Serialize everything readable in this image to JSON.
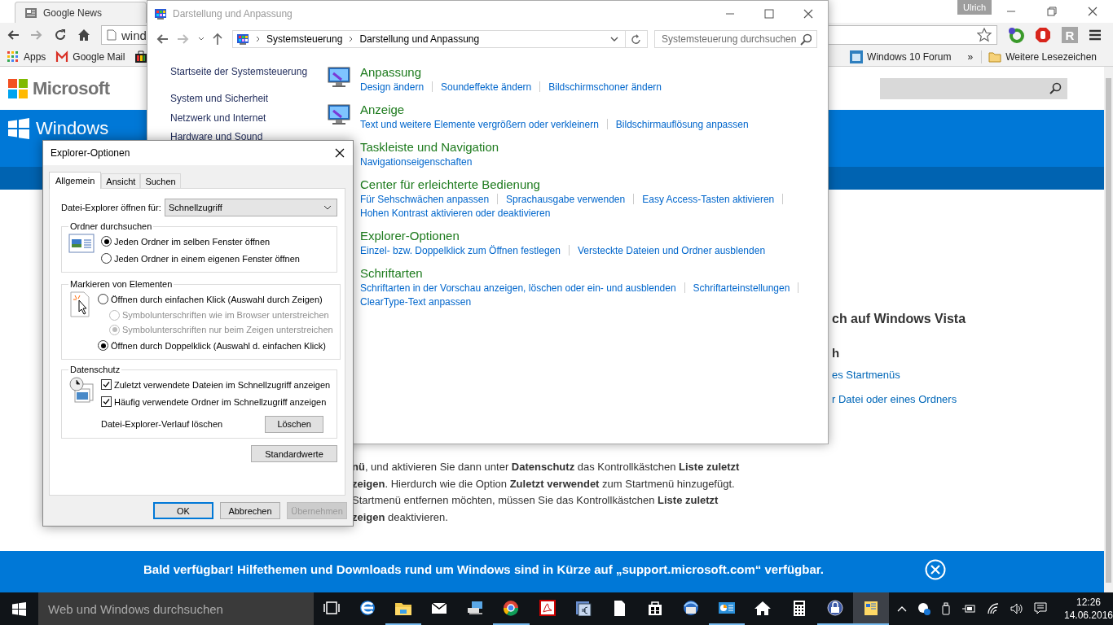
{
  "browser": {
    "tab": {
      "title": "Google News"
    },
    "profile": "Ulrich",
    "address": "wind",
    "extension_label": "R",
    "bookmarks": [
      {
        "kind": "apps",
        "label": "Apps"
      },
      {
        "kind": "mail",
        "label": "Google Mail"
      },
      {
        "kind": "bag"
      }
    ],
    "bookmarks_right": [
      {
        "kind": "forum",
        "label": "Windows 10 Forum"
      }
    ],
    "overflow": "»",
    "other_bookmarks": "Weitere Lesezeichen"
  },
  "site": {
    "brand": "Microsoft",
    "band_title": "Windows",
    "article": {
      "heading": "ch auf Windows Vista",
      "subheading": "h",
      "links": [
        "es Startmenüs",
        "r Datei oder eines Ordners"
      ],
      "paragraph_lines": [
        "**nü**, und aktivieren Sie dann unter **Datenschutz** das Kontrollkästchen **Liste zuletzt**",
        "**zeigen**. Hierdurch wie die Option **Zuletzt verwendet** zum Startmenü hinzugefügt.",
        "Startmenü entfernen möchten, müssen Sie das Kontrollkästchen **Liste zuletzt**",
        "**zeigen** deaktivieren."
      ]
    },
    "banner": {
      "text": "Bald verfügbar! Hilfethemen und Downloads rund um Windows sind in Kürze auf „support.microsoft.com“ verfügbar."
    }
  },
  "control_panel": {
    "title": "Darstellung und Anpassung",
    "breadcrumb": [
      "Systemsteuerung",
      "Darstellung und Anpassung"
    ],
    "search_placeholder": "Systemsteuerung durchsuchen",
    "nav": [
      "Startseite der Systemsteuerung",
      "System und Sicherheit",
      "Netzwerk und Internet",
      "Hardware und Sound"
    ],
    "categories": [
      {
        "title": "Anpassung",
        "link_rows": [
          [
            "Design ändern",
            "Soundeffekte ändern",
            "Bildschirmschoner ändern"
          ]
        ]
      },
      {
        "title": "Anzeige",
        "link_rows": [
          [
            "Text und weitere Elemente vergrößern oder verkleinern",
            "Bildschirmauflösung anpassen"
          ]
        ]
      },
      {
        "title": "Taskleiste und Navigation",
        "link_rows": [
          [
            "Navigationseigenschaften"
          ]
        ]
      },
      {
        "title": "Center für erleichterte Bedienung",
        "link_rows": [
          [
            "Für Sehschwächen anpassen",
            "Sprachausgabe verwenden",
            "Easy Access-Tasten aktivieren"
          ],
          [
            "Hohen Kontrast aktivieren oder deaktivieren"
          ]
        ]
      },
      {
        "title": "Explorer-Optionen",
        "link_rows": [
          [
            "Einzel- bzw. Doppelklick zum Öffnen festlegen",
            "Versteckte Dateien und Ordner ausblenden"
          ]
        ]
      },
      {
        "title": "Schriftarten",
        "link_rows": [
          [
            "Schriftarten in der Vorschau anzeigen, löschen oder ein- und ausblenden",
            "Schriftarteinstellungen"
          ],
          [
            "ClearType-Text anpassen"
          ]
        ]
      }
    ]
  },
  "dialog": {
    "title": "Explorer-Optionen",
    "tabs": [
      {
        "label": "Allgemein",
        "selected": true
      },
      {
        "label": "Ansicht",
        "selected": false
      },
      {
        "label": "Suchen",
        "selected": false
      }
    ],
    "open_in": {
      "label": "Datei-Explorer öffnen für:",
      "value": "Schnellzugriff"
    },
    "groups": [
      {
        "kind": "radios",
        "title": "Ordner durchsuchen",
        "options": [
          {
            "label": "Jeden Ordner im selben Fenster öffnen",
            "selected": true,
            "disabled": false
          },
          {
            "label": "Jeden Ordner in einem eigenen Fenster öffnen",
            "selected": false,
            "disabled": false
          }
        ]
      },
      {
        "kind": "radios",
        "title": "Markieren von Elementen",
        "options": [
          {
            "label": "Öffnen durch einfachen Klick (Auswahl durch Zeigen)",
            "selected": false,
            "disabled": false,
            "children": [
              {
                "label": "Symbolunterschriften wie im Browser unterstreichen",
                "selected": false,
                "disabled": true
              },
              {
                "label": "Symbolunterschriften nur beim Zeigen unterstreichen",
                "selected": true,
                "disabled": true
              }
            ]
          },
          {
            "label": "Öffnen durch Doppelklick (Auswahl d. einfachen Klick)",
            "selected": true,
            "disabled": false
          }
        ]
      },
      {
        "kind": "checks",
        "title": "Datenschutz",
        "options": [
          {
            "label": "Zuletzt verwendete Dateien im Schnellzugriff anzeigen",
            "checked": true
          },
          {
            "label": "Häufig verwendete Ordner im Schnellzugriff anzeigen",
            "checked": true
          }
        ],
        "clear": {
          "label": "Datei-Explorer-Verlauf löschen",
          "button": "Löschen"
        }
      }
    ],
    "defaults_button": "Standardwerte",
    "buttons": [
      {
        "label": "OK",
        "default": true,
        "disabled": false
      },
      {
        "label": "Abbrechen",
        "default": false,
        "disabled": false
      },
      {
        "label": "Übernehmen",
        "default": false,
        "disabled": true
      }
    ]
  },
  "taskbar": {
    "search_placeholder": "Web und Windows durchsuchen",
    "apps": [
      {
        "kind": "taskview",
        "running": false,
        "active": false
      },
      {
        "kind": "letter",
        "running": false,
        "active": false
      },
      {
        "kind": "folder",
        "running": true,
        "active": false
      },
      {
        "kind": "envelope",
        "running": false,
        "active": false
      },
      {
        "kind": "computer",
        "running": false,
        "active": false
      },
      {
        "kind": "ball",
        "running": true,
        "active": false
      },
      {
        "kind": "pdf",
        "running": false,
        "active": false
      },
      {
        "kind": "euro",
        "running": false,
        "active": false
      },
      {
        "kind": "page",
        "running": false,
        "active": false
      },
      {
        "kind": "bag",
        "running": false,
        "active": false
      },
      {
        "kind": "bird",
        "running": false,
        "active": false
      },
      {
        "kind": "chart",
        "running": true,
        "active": false
      },
      {
        "kind": "house",
        "running": false,
        "active": false
      },
      {
        "kind": "calculator",
        "running": false,
        "active": false
      },
      {
        "kind": "padlock",
        "running": true,
        "active": false
      },
      {
        "kind": "note",
        "running": true,
        "active": true
      }
    ],
    "time": "12:26",
    "date": "14.06.2016"
  }
}
